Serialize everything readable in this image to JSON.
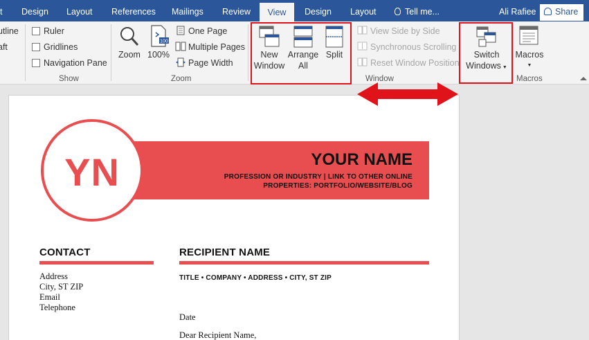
{
  "tabs": [
    {
      "label": "t"
    },
    {
      "label": "Design"
    },
    {
      "label": "Layout"
    },
    {
      "label": "References"
    },
    {
      "label": "Mailings"
    },
    {
      "label": "Review"
    },
    {
      "label": "View"
    },
    {
      "label": "Design"
    },
    {
      "label": "Layout"
    }
  ],
  "tell_me": "Tell me...",
  "user_name": "Ali Rafiee",
  "share_label": "Share",
  "show_group": {
    "partial_items": [
      "utline",
      "aft"
    ],
    "ruler": "Ruler",
    "gridlines": "Gridlines",
    "navigation_pane": "Navigation Pane",
    "label": "Show"
  },
  "zoom_group": {
    "zoom": "Zoom",
    "zoom100": "100%",
    "one_page": "One Page",
    "multiple_pages": "Multiple Pages",
    "page_width": "Page Width",
    "label": "Zoom"
  },
  "window_group": {
    "new_window": [
      "New",
      "Window"
    ],
    "arrange_all": [
      "Arrange",
      "All"
    ],
    "split": "Split",
    "view_side_by_side": "View Side by Side",
    "synchronous_scrolling": "Synchronous Scrolling",
    "reset_window_position": "Reset Window Position",
    "label": "Window"
  },
  "switch_windows": [
    "Switch",
    "Windows"
  ],
  "macros": {
    "label": "Macros",
    "group_label": "Macros"
  },
  "document": {
    "monogram": "YN",
    "name": "YOUR NAME",
    "tagline": [
      "PROFESSION OR INDUSTRY | LINK TO OTHER ONLINE",
      "PROPERTIES: PORTFOLIO/WEBSITE/BLOG"
    ],
    "contact_title": "CONTACT",
    "contact_lines": [
      "Address",
      "City, ST ZIP",
      "Email",
      "Telephone"
    ],
    "recipient_title": "RECIPIENT NAME",
    "recipient_details": "TITLE • COMPANY • ADDRESS • CITY, ST ZIP",
    "date": "Date",
    "salutation": "Dear Recipient Name,"
  },
  "colors": {
    "accent": "#e84e50",
    "ribbon_blue": "#2b579a",
    "highlight_red": "#e0131a"
  }
}
